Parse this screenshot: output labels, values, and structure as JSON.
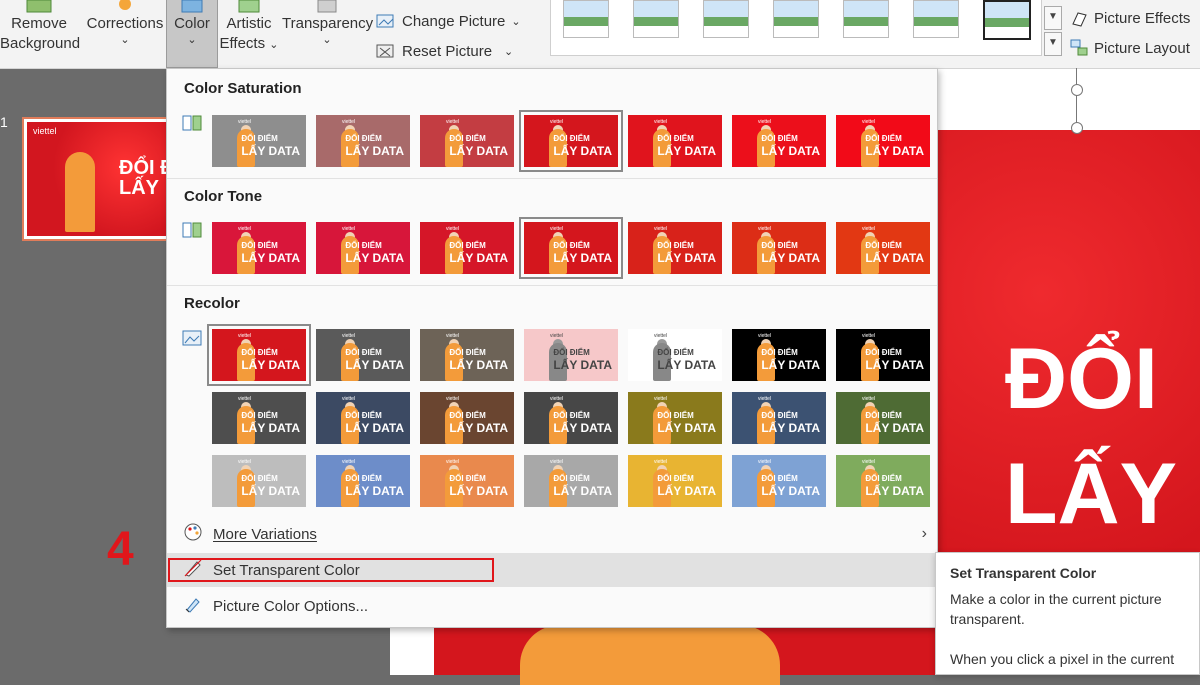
{
  "ribbon": {
    "remove_background": {
      "line1": "Remove",
      "line2": "Background"
    },
    "corrections": "Corrections",
    "color": "Color",
    "artistic_effects": {
      "line1": "Artistic",
      "line2": "Effects"
    },
    "transparency": "Transparency",
    "change_picture": "Change Picture",
    "reset_picture": "Reset Picture",
    "picture_effects": "Picture Effects",
    "picture_layout": "Picture Layout",
    "dropdown_chevron": "⌄"
  },
  "slide_pane": {
    "slide_number": "1"
  },
  "slide": {
    "line1": "ĐỔI",
    "line2": "LẤY"
  },
  "thumb_text": {
    "brand": "viettel",
    "line1": "ĐỔI ĐI",
    "line2": "LẤY"
  },
  "tile_text": {
    "logo": "viettel",
    "line1": "ĐỔI ĐIỂM",
    "line2": "LẤY DATA"
  },
  "menu": {
    "saturation_header": "Color Saturation",
    "tone_header": "Color Tone",
    "recolor_header": "Recolor",
    "more_variations": "More Variations",
    "set_transparent": "Set Transparent Color",
    "picture_color_options": "Picture Color Options...",
    "submenu_arrow": "›"
  },
  "annotation": {
    "step_number": "4",
    "color": "#e0161b"
  },
  "tooltip": {
    "title": "Set Transparent Color",
    "body": "Make a color in the current picture transparent.",
    "body2": "When you click a pixel in the current picture, all pixels of that color"
  },
  "colors": {
    "brand_red": "#d4161d",
    "accent_orange": "#f39b3a"
  }
}
